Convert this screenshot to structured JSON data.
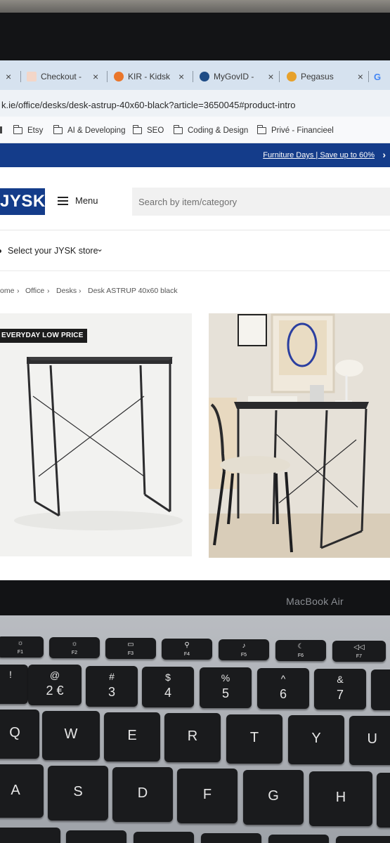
{
  "browser": {
    "tabs": [
      {
        "label": "Checkout -",
        "close": "×"
      },
      {
        "label": "KIR - Kidsk",
        "close": "×"
      },
      {
        "label": "MyGovID -",
        "close": "×"
      },
      {
        "label": "Pegasus",
        "close": "×"
      }
    ],
    "first_tab_close": "×",
    "partial_tab_letter": "G",
    "url": "k.ie/office/desks/desk-astrup-40x60-black?article=3650045#product-intro",
    "bookmarks": [
      "Etsy",
      "AI & Developing",
      "SEO",
      "Coding & Design",
      "Privé - Financieel"
    ]
  },
  "site": {
    "promo": "Furniture Days | Save up to 60%",
    "promo_chevron": "›",
    "logo": "JYSK",
    "menu_label": "Menu",
    "search_placeholder": "Search by item/category",
    "store_label": "Select your JYSK store",
    "store_chevron": "⌄",
    "breadcrumb": [
      "ome",
      "Office",
      "Desks",
      "Desk ASTRUP 40x60 black"
    ],
    "breadcrumb_sep": "›",
    "badge": "EVERYDAY LOW PRICE"
  },
  "laptop": {
    "brand": "MacBook Air",
    "fn_keys": [
      {
        "icon": "☼",
        "label": "F1"
      },
      {
        "icon": "☼",
        "label": "F2"
      },
      {
        "icon": "▭",
        "label": "F3"
      },
      {
        "icon": "⚲",
        "label": "F4"
      },
      {
        "icon": "♪",
        "label": "F5"
      },
      {
        "icon": "☾",
        "label": "F6"
      },
      {
        "icon": "◁◁",
        "label": "F7"
      }
    ],
    "number_keys": [
      {
        "top": "!",
        "main": ""
      },
      {
        "top": "@",
        "main": "2 €"
      },
      {
        "top": "#",
        "main": "3"
      },
      {
        "top": "$",
        "main": "4"
      },
      {
        "top": "%",
        "main": "5"
      },
      {
        "top": "^",
        "main": "6"
      },
      {
        "top": "&",
        "main": "7"
      }
    ],
    "letter_row_1": [
      "Q",
      "W",
      "E",
      "R",
      "T",
      "Y",
      "U"
    ],
    "letter_row_2": [
      "A",
      "S",
      "D",
      "F",
      "G",
      "H"
    ]
  }
}
